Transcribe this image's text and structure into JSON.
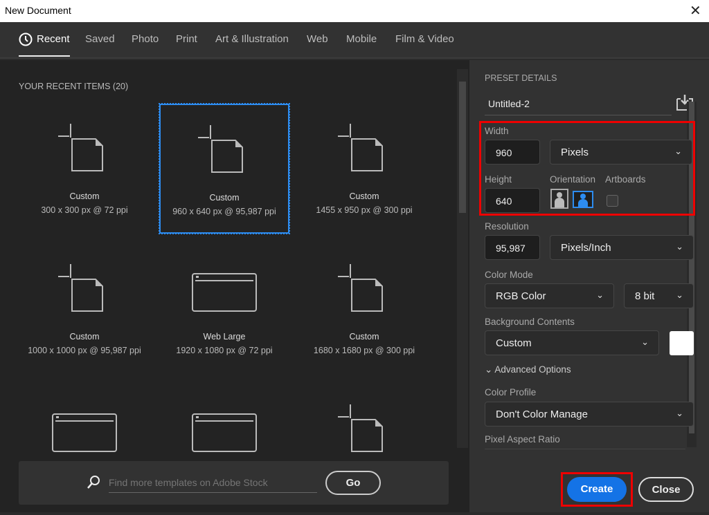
{
  "window": {
    "title": "New Document",
    "close": "✕"
  },
  "tabs": [
    "Recent",
    "Saved",
    "Photo",
    "Print",
    "Art & Illustration",
    "Web",
    "Mobile",
    "Film & Video"
  ],
  "recent": {
    "title": "YOUR RECENT ITEMS",
    "count": "(20)",
    "items": [
      {
        "name": "Custom",
        "desc": "300 x 300 px @ 72 ppi",
        "icon": "document"
      },
      {
        "name": "Custom",
        "desc": "960 x 640 px @ 95,987 ppi",
        "icon": "document",
        "selected": true
      },
      {
        "name": "Custom",
        "desc": "1455 x 950 px @ 300 ppi",
        "icon": "document"
      },
      {
        "name": "Custom",
        "desc": "1000 x 1000 px @ 95,987 ppi",
        "icon": "document"
      },
      {
        "name": "Web Large",
        "desc": "1920 x 1080 px @ 72 ppi",
        "icon": "web"
      },
      {
        "name": "Custom",
        "desc": "1680 x 1680 px @ 300 ppi",
        "icon": "document"
      },
      {
        "name": "",
        "desc": "",
        "icon": "web"
      },
      {
        "name": "",
        "desc": "",
        "icon": "web"
      },
      {
        "name": "",
        "desc": "",
        "icon": "document"
      }
    ]
  },
  "search": {
    "placeholder": "Find more templates on Adobe Stock",
    "go": "Go"
  },
  "preset": {
    "title": "PRESET DETAILS",
    "name": "Untitled-2",
    "width_label": "Width",
    "width": "960",
    "unit": "Pixels",
    "height_label": "Height",
    "height": "640",
    "orientation_label": "Orientation",
    "artboards_label": "Artboards",
    "resolution_label": "Resolution",
    "resolution": "95,987",
    "resolution_unit": "Pixels/Inch",
    "color_mode_label": "Color Mode",
    "color_mode": "RGB Color",
    "bit_depth": "8 bit",
    "background_label": "Background Contents",
    "background": "Custom",
    "advanced": "Advanced Options",
    "color_profile_label": "Color Profile",
    "color_profile": "Don't Color Manage",
    "pixel_aspect_label": "Pixel Aspect Ratio"
  },
  "buttons": {
    "create": "Create",
    "close": "Close"
  },
  "colors": {
    "accent": "#1473e6",
    "highlight": "#e00000"
  }
}
